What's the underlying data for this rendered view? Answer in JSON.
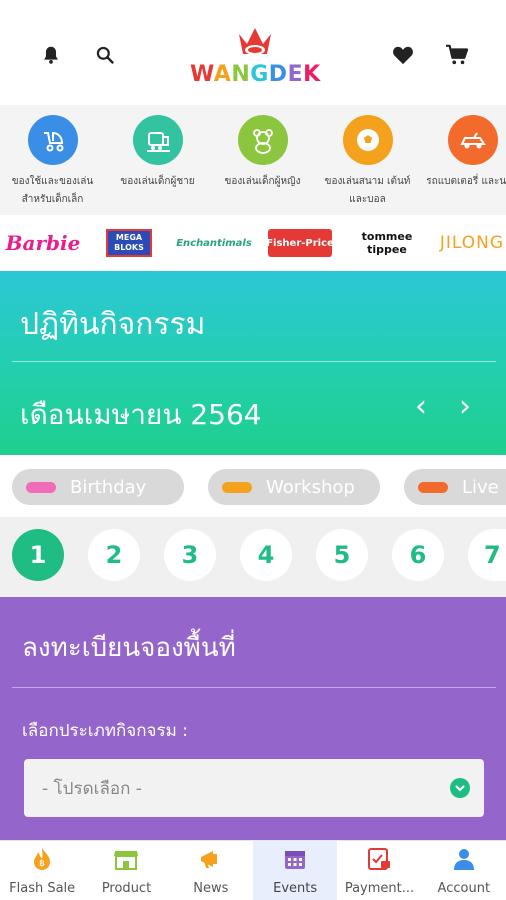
{
  "header": {
    "logo_text": "WANGDEK",
    "icons": [
      "bell-icon",
      "search-icon",
      "heart-icon",
      "cart-icon"
    ]
  },
  "categories": [
    {
      "label": "ของใช้และของเล่นสำหรับเด็กเล็ก",
      "icon": "stroller-icon",
      "color": "#3a8ee6"
    },
    {
      "label": "ของเล่นเด็กผู้ชาย",
      "icon": "train-icon",
      "color": "#34c3a0"
    },
    {
      "label": "ของเล่นเด็กผู้หญิง",
      "icon": "bear-icon",
      "color": "#8cc63f"
    },
    {
      "label": "ของเล่นสนาม เต้นท์ และบอล",
      "icon": "ball-icon",
      "color": "#f4a21e"
    },
    {
      "label": "รถแบตเตอรี่ และนาฬิ",
      "icon": "car-icon",
      "color": "#f26b2d"
    }
  ],
  "brands": [
    "Barbie",
    "MEGA BLOKS",
    "Enchantimals",
    "Fisher-Price",
    "tommee tippee",
    "JILONG"
  ],
  "calendar": {
    "title": "ปฏิทินกิจกรรม",
    "month": "เดือนเมษายน 2564",
    "prev": "‹",
    "next": "›"
  },
  "legend": [
    {
      "label": "Birthday",
      "color": "#f06bb8"
    },
    {
      "label": "Workshop",
      "color": "#f4a21e"
    },
    {
      "label": "Live",
      "color": "#f26b2d"
    }
  ],
  "days": [
    "1",
    "2",
    "3",
    "4",
    "5",
    "6",
    "7"
  ],
  "selected_day": "1",
  "register": {
    "title": "ลงทะเบียนจองพื้นที่",
    "label": "เลือกประเภทกิจกจรม :",
    "select_placeholder": "- โปรดเลือก -"
  },
  "bottom_nav": [
    {
      "label": "Flash Sale",
      "icon": "flame-icon"
    },
    {
      "label": "Product",
      "icon": "store-icon"
    },
    {
      "label": "News",
      "icon": "megaphone-icon"
    },
    {
      "label": "Events",
      "icon": "calendar-icon"
    },
    {
      "label": "Payment...",
      "icon": "payment-icon"
    },
    {
      "label": "Account",
      "icon": "account-icon"
    }
  ],
  "active_tab": "Events",
  "colors": {
    "accent_green": "#1fbd83",
    "purple": "#9466cc",
    "teal": "#2cc7d7"
  }
}
